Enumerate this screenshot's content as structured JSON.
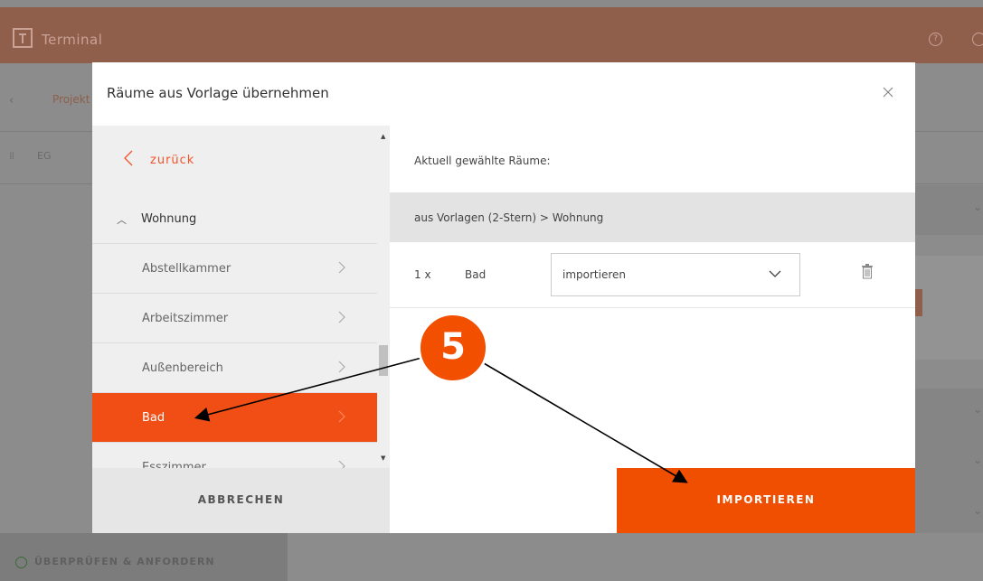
{
  "app": {
    "title": "Terminal",
    "help_icon_glyph": "?",
    "breadcrumb": "Projekt",
    "floor_label": "EG",
    "footer_action": "ÜBERPRÜFEN & ANFORDERN"
  },
  "modal": {
    "title": "Räume aus Vorlage übernehmen",
    "back_label": "zurück",
    "tree": {
      "group_label": "Wohnung",
      "items": [
        {
          "label": "Abstellkammer",
          "selected": false
        },
        {
          "label": "Arbeitszimmer",
          "selected": false
        },
        {
          "label": "Außenbereich",
          "selected": false
        },
        {
          "label": "Bad",
          "selected": true
        },
        {
          "label": "Esszimmer",
          "selected": false
        }
      ]
    },
    "selected_heading": "Aktuell gewählte Räume:",
    "selected_group": "aus Vorlagen (2-Stern) > Wohnung",
    "rooms": [
      {
        "qty": "1 x",
        "name": "Bad",
        "action": "importieren"
      }
    ],
    "cancel_label": "ABBRECHEN",
    "import_label": "IMPORTIEREN"
  },
  "annotation": {
    "step_number": "5"
  },
  "colors": {
    "accent": "#f04e15",
    "header_dimmed": "#8f5f4c",
    "overlay": "#8a8a8a"
  }
}
